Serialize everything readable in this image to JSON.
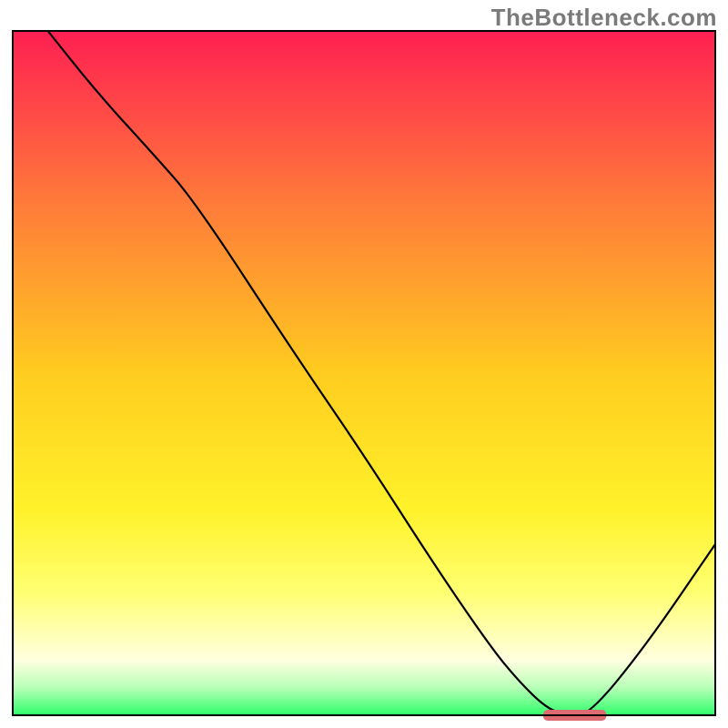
{
  "watermark": "TheBottleneck.com",
  "chart_data": {
    "type": "line",
    "title": "",
    "xlabel": "",
    "ylabel": "",
    "xlim": [
      0,
      100
    ],
    "ylim": [
      0,
      100
    ],
    "grid": false,
    "legend": false,
    "background_gradient": {
      "stops": [
        {
          "offset": 0.0,
          "color": "#ff1f52"
        },
        {
          "offset": 0.25,
          "color": "#ff7a3a"
        },
        {
          "offset": 0.5,
          "color": "#ffcc1f"
        },
        {
          "offset": 0.7,
          "color": "#fff22a"
        },
        {
          "offset": 0.82,
          "color": "#ffff72"
        },
        {
          "offset": 0.92,
          "color": "#ffffe0"
        },
        {
          "offset": 0.96,
          "color": "#b6ffb6"
        },
        {
          "offset": 1.0,
          "color": "#2eff6a"
        }
      ]
    },
    "series": [
      {
        "name": "bottleneck-curve",
        "stroke": "#000000",
        "stroke_width": 2.2,
        "x": [
          5,
          12,
          20,
          26,
          40,
          50,
          60,
          68,
          72,
          76,
          79,
          82,
          90,
          100
        ],
        "y": [
          100,
          91,
          82,
          75,
          53,
          38,
          22,
          10,
          5,
          1,
          0,
          0,
          10,
          25
        ]
      }
    ],
    "marker": {
      "name": "optimal-zone-marker",
      "x_center": 80,
      "y": 0,
      "width": 9,
      "height": 1.6,
      "color": "#dd6b72",
      "rx": 5
    }
  }
}
